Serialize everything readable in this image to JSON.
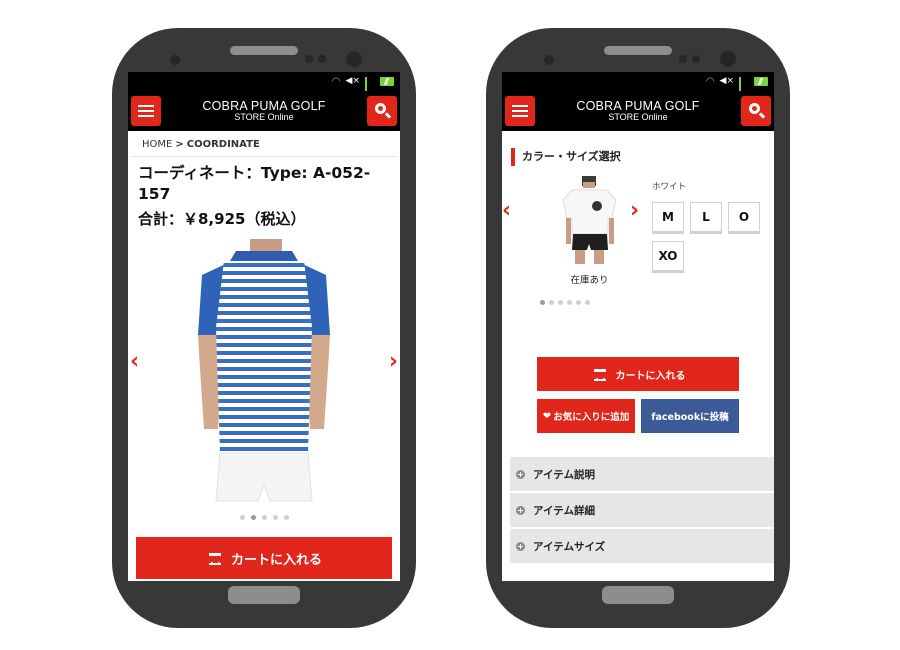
{
  "store": {
    "logo_line1": "COBRA PUMA GOLF",
    "logo_line2": "STORE Online"
  },
  "left_screen": {
    "breadcrumb": {
      "home": "HOME",
      "separator": ">",
      "current": "COORDINATE"
    },
    "product_title": "コーディネート：Type: A-052-157",
    "total": "合計：￥8,925（税込）",
    "carousel_dots": 5,
    "active_dot": 2,
    "cart_button": "カートに入れる"
  },
  "right_screen": {
    "section_title": "カラー・サイズ選択",
    "color_name": "ホワイト",
    "sizes": [
      "M",
      "L",
      "O",
      "XO"
    ],
    "stock_status": "在庫あり",
    "carousel_dots": 6,
    "active_dot": 1,
    "cart_button": "カートに入れる",
    "favorite_button": "お気に入りに追加",
    "facebook_button": "facebookに投稿",
    "accordion": [
      "アイテム説明",
      "アイテム詳細",
      "アイテムサイズ"
    ]
  },
  "colors": {
    "accent_red": "#e1261c",
    "facebook_blue": "#3b5a98",
    "phone_body": "#383838",
    "stripe_blue": "#3a6fc4"
  },
  "icons": [
    "menu-icon",
    "search-icon",
    "chevron-left-icon",
    "chevron-right-icon",
    "cart-icon",
    "heart-icon",
    "plus-circle-icon",
    "wifi-icon",
    "mute-icon",
    "signal-icon",
    "battery-icon"
  ]
}
